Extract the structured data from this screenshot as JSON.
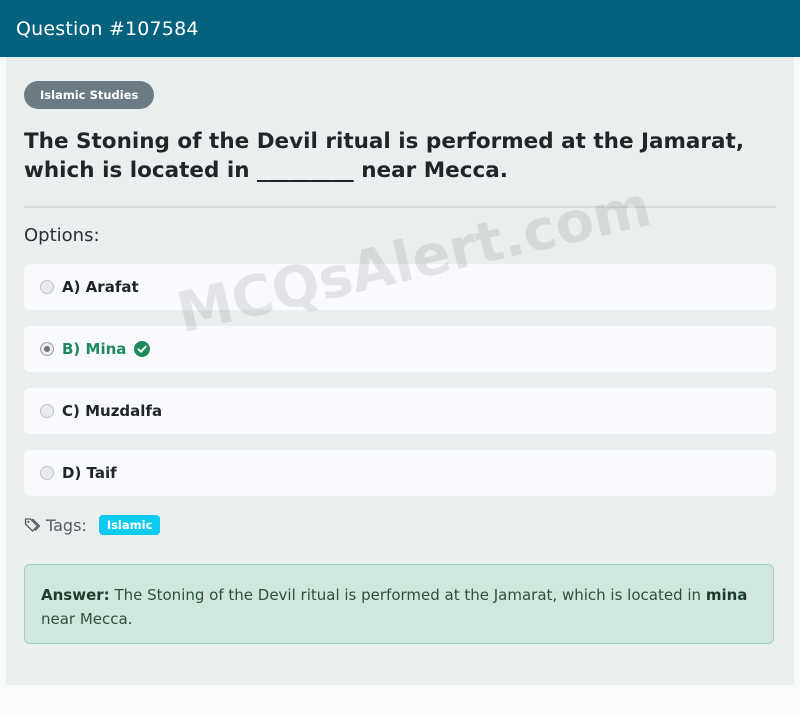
{
  "header": {
    "title": "Question #107584"
  },
  "category": "Islamic Studies",
  "question": "The Stoning of the Devil ritual is performed at the Jamarat, which is located in _________ near Mecca.",
  "options_label": "Options:",
  "options": [
    {
      "label": "A) Arafat",
      "selected": false,
      "correct": false
    },
    {
      "label": "B) Mina",
      "selected": true,
      "correct": true
    },
    {
      "label": "C) Muzdalfa",
      "selected": false,
      "correct": false
    },
    {
      "label": "D) Taif",
      "selected": false,
      "correct": false
    }
  ],
  "tags_label": "Tags:",
  "tags": [
    "Islamic"
  ],
  "answer": {
    "prefix": "Answer:",
    "text_before": "The Stoning of the Devil ritual is performed at the Jamarat, which is located in",
    "highlight": "mina",
    "text_after": "near Mecca."
  },
  "watermark": "MCQsAlert.com",
  "colors": {
    "header_bg": "#04627f",
    "correct_green": "#1f8a5b",
    "tag_cyan": "#0dcaf0",
    "answer_bg": "#d1e7dd"
  }
}
